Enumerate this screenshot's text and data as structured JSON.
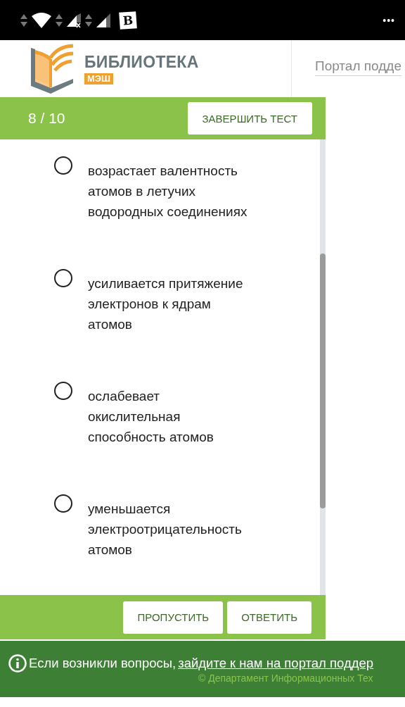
{
  "status_bar": {
    "app_badge": "B",
    "menu": "•••"
  },
  "header": {
    "logo_title": "БИБЛИОТЕКА",
    "logo_badge": "МЭШ",
    "portal_link": "Портал подде"
  },
  "test_bar": {
    "progress": "8 / 10",
    "finish_button": "ЗАВЕРШИТЬ ТЕСТ"
  },
  "options": [
    {
      "text": "возрастает валентность атомов в летучих водородных соединениях",
      "selected": false
    },
    {
      "text": "усиливается притяжение электронов к ядрам атомов",
      "selected": false
    },
    {
      "text": "ослабевает окислительная способность атомов",
      "selected": false
    },
    {
      "text": "уменьшается электроотрицательность атомов",
      "selected": false
    }
  ],
  "actions": [
    "ПРОПУСТИТЬ",
    "ОТВЕТИТЬ"
  ],
  "footer": {
    "text": "Если возникли вопросы,",
    "link": "зайдите к нам на портал поддер",
    "copyright": "© Департамент Информационных Тех"
  }
}
